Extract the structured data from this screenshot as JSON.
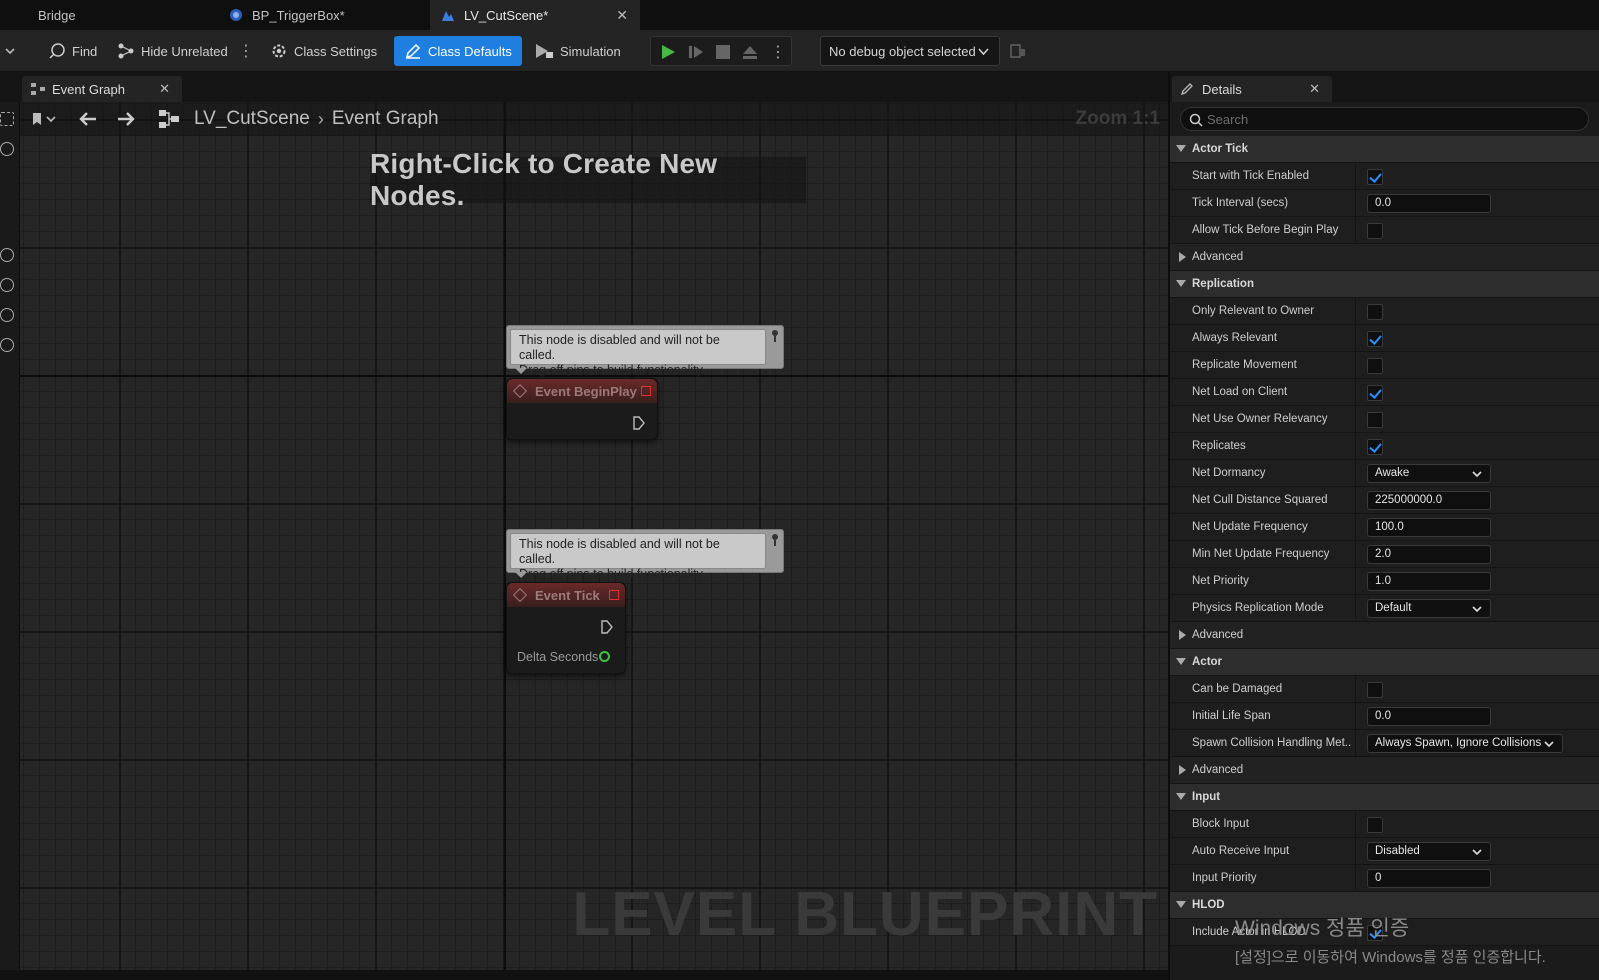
{
  "tabs": [
    {
      "label": "Bridge"
    },
    {
      "label": "BP_TriggerBox*"
    },
    {
      "label": "LV_CutScene*"
    }
  ],
  "toolbar": {
    "find": "Find",
    "hide_unrelated": "Hide Unrelated",
    "class_settings": "Class Settings",
    "class_defaults": "Class Defaults",
    "simulation": "Simulation",
    "debug_object": "No debug object selected"
  },
  "graph": {
    "panel_tab": "Event Graph",
    "breadcrumb_root": "LV_CutScene",
    "breadcrumb_leaf": "Event Graph",
    "zoom": "Zoom 1:1",
    "hint": "Right-Click to Create New Nodes.",
    "watermark": "LEVEL BLUEPRINT",
    "disabled_comment_line1": "This node is disabled and will not be called.",
    "disabled_comment_line2": "Drag off pins to build functionality.",
    "nodes": {
      "begin_play": "Event BeginPlay",
      "tick": "Event Tick",
      "delta_seconds": "Delta Seconds"
    }
  },
  "details": {
    "tab": "Details",
    "search_placeholder": "Search",
    "rows": [
      {
        "kind": "cat",
        "label": "Actor Tick"
      },
      {
        "kind": "check",
        "label": "Start with Tick Enabled",
        "checked": true
      },
      {
        "kind": "field",
        "label": "Tick Interval (secs)",
        "value": "0.0"
      },
      {
        "kind": "check",
        "label": "Allow Tick Before Begin Play",
        "checked": false
      },
      {
        "kind": "adv",
        "label": "Advanced"
      },
      {
        "kind": "cat",
        "label": "Replication"
      },
      {
        "kind": "check",
        "label": "Only Relevant to Owner",
        "checked": false
      },
      {
        "kind": "check",
        "label": "Always Relevant",
        "checked": true
      },
      {
        "kind": "check",
        "label": "Replicate Movement",
        "checked": false
      },
      {
        "kind": "check",
        "label": "Net Load on Client",
        "checked": true
      },
      {
        "kind": "check",
        "label": "Net Use Owner Relevancy",
        "checked": false
      },
      {
        "kind": "check",
        "label": "Replicates",
        "checked": true
      },
      {
        "kind": "combo",
        "label": "Net Dormancy",
        "value": "Awake"
      },
      {
        "kind": "field",
        "label": "Net Cull Distance Squared",
        "value": "225000000.0"
      },
      {
        "kind": "field",
        "label": "Net Update Frequency",
        "value": "100.0"
      },
      {
        "kind": "field",
        "label": "Min Net Update Frequency",
        "value": "2.0"
      },
      {
        "kind": "field",
        "label": "Net Priority",
        "value": "1.0"
      },
      {
        "kind": "combo",
        "label": "Physics Replication Mode",
        "value": "Default"
      },
      {
        "kind": "adv",
        "label": "Advanced"
      },
      {
        "kind": "cat",
        "label": "Actor"
      },
      {
        "kind": "check",
        "label": "Can be Damaged",
        "checked": false
      },
      {
        "kind": "field",
        "label": "Initial Life Span",
        "value": "0.0"
      },
      {
        "kind": "combo-wide",
        "label": "Spawn Collision Handling Met...",
        "value": "Always Spawn, Ignore Collisions"
      },
      {
        "kind": "adv",
        "label": "Advanced"
      },
      {
        "kind": "cat",
        "label": "Input"
      },
      {
        "kind": "check",
        "label": "Block Input",
        "checked": false
      },
      {
        "kind": "combo",
        "label": "Auto Receive Input",
        "value": "Disabled"
      },
      {
        "kind": "field",
        "label": "Input Priority",
        "value": "0"
      },
      {
        "kind": "cat",
        "label": "HLOD"
      },
      {
        "kind": "check",
        "label": "Include Actor in HLOD",
        "checked": true
      }
    ]
  },
  "windows_activation": {
    "line1": "Windows 정품 인증",
    "line2": "[설정]으로 이동하여 Windows를 정품 인증합니다."
  },
  "colors": {
    "accent": "#1f7fe0",
    "check": "#2a8fff",
    "disabled_node_header": "#6a2a2a",
    "exec_pin_red": "#e03030",
    "float_pin": "#3ec13e"
  }
}
